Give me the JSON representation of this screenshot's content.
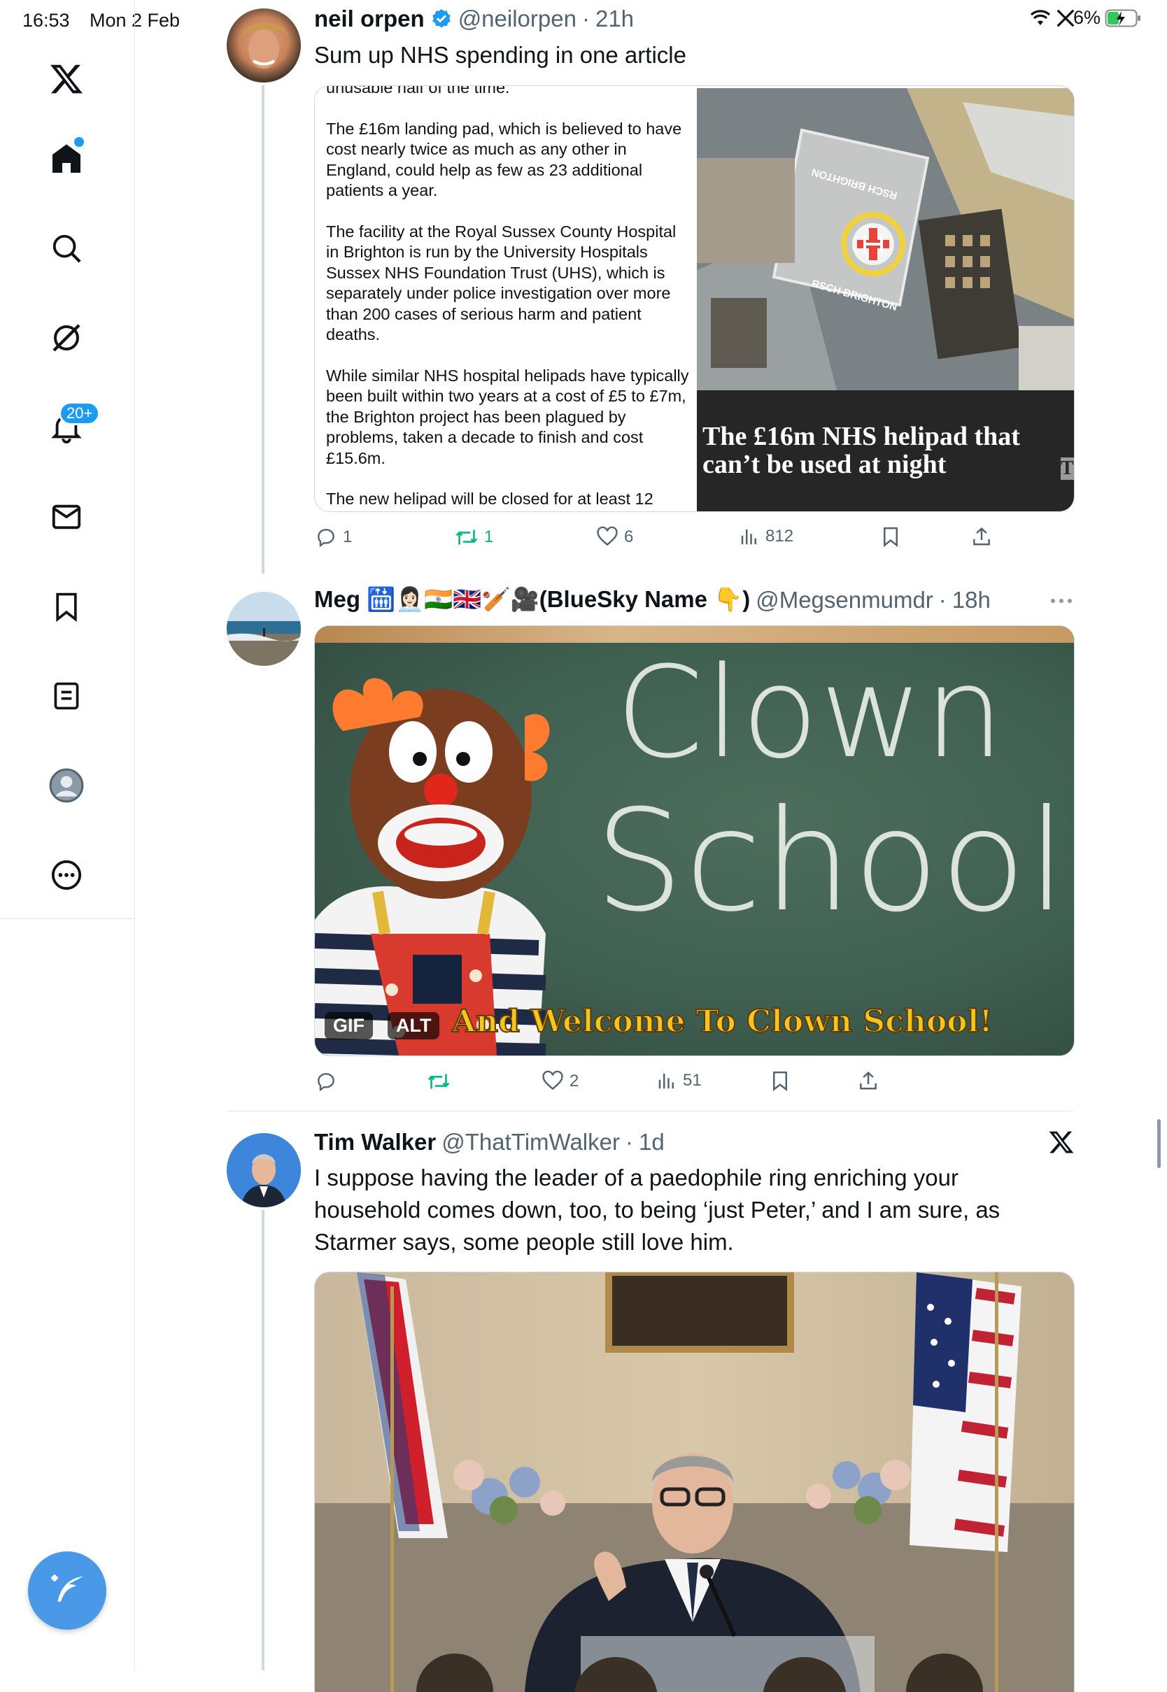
{
  "status_bar": {
    "time": "16:53",
    "date": "Mon 2 Feb",
    "battery": "6%"
  },
  "sidebar": {
    "items": [
      {
        "name": "x-logo-icon"
      },
      {
        "name": "home-icon"
      },
      {
        "name": "search-icon"
      },
      {
        "name": "grok-icon"
      },
      {
        "name": "notifications-icon",
        "badge": "20+"
      },
      {
        "name": "messages-icon"
      },
      {
        "name": "bookmarks-icon"
      },
      {
        "name": "lists-icon"
      },
      {
        "name": "profile-icon"
      },
      {
        "name": "more-icon"
      }
    ],
    "compose": "compose-icon"
  },
  "tweets": [
    {
      "name": "neil orpen",
      "handle": "@neilorpen",
      "sep": "·",
      "time": "21h",
      "text": "Sum up NHS spending in one article",
      "article": {
        "p0": "unusable half of the time.",
        "p1": "The £16m landing pad, which is believed to have cost nearly twice as much as any other in England, could help as few as 23 additional patients a year.",
        "p2": "The facility at the Royal Sussex County Hospital in Brighton is run by the University Hospitals Sussex NHS Foundation Trust (UHS), which is separately under police investigation over more than 200 cases of serious harm and patient deaths.",
        "p3": "While similar NHS hospital helipads have typically been built within two years at a cost of £5 to £7m, the Brighton project has been plagued by problems, taken a decade to finish and cost £15.6m.",
        "p4": "The new helipad will be closed for at least 12",
        "headline": "The £16m NHS helipad that can’t be used at night",
        "headline_edge": "T",
        "helipad_top": "RSCH BRIGHTON",
        "helipad_bottom": "RSCH BRIGHTON"
      },
      "actions": {
        "replies": "1",
        "reposts": "1",
        "likes": "6",
        "views": "812"
      }
    },
    {
      "name": "Meg 🛗👩🏻‍💼🇮🇳🇬🇧🏏🎥(BlueSky Name 👇)",
      "handle": "@Megsenmumdr",
      "sep": "·",
      "time": "18h",
      "gif": {
        "board_line1": "Clown",
        "board_line2": "School",
        "caption": "And Welcome To Clown School!",
        "gif_chip": "GIF",
        "alt_chip": "ALT"
      },
      "actions": {
        "replies": "",
        "reposts": "",
        "likes": "2",
        "views": "51"
      }
    },
    {
      "name": "Tim Walker",
      "handle": "@ThatTimWalker",
      "sep": "·",
      "time": "1d",
      "text": "I suppose having the leader of a paedophile ring enriching your household comes down, too, to being ‘just Peter,’ and I am sure, as Starmer says, some people still love him."
    }
  ],
  "colors": {
    "accent": "#1d9bf0",
    "repost_green": "#00ba7c",
    "muted": "#536471"
  }
}
